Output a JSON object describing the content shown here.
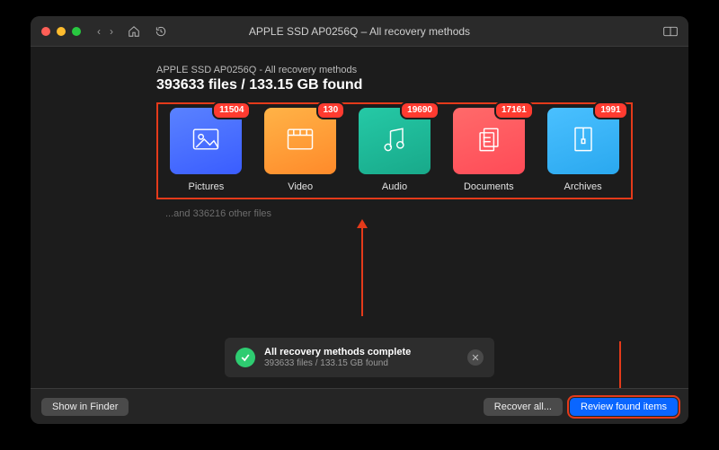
{
  "titlebar": {
    "title": "APPLE SSD AP0256Q – All recovery methods"
  },
  "header": {
    "breadcrumb": "APPLE SSD AP0256Q - All recovery methods",
    "headline": "393633 files / 133.15 GB found"
  },
  "categories": [
    {
      "name": "pictures",
      "label": "Pictures",
      "count": "11504",
      "color": "linear-gradient(160deg,#5a82ff,#3a5dff)"
    },
    {
      "name": "video",
      "label": "Video",
      "count": "130",
      "color": "linear-gradient(160deg,#ffb347,#ff8a2a)"
    },
    {
      "name": "audio",
      "label": "Audio",
      "count": "19690",
      "color": "linear-gradient(160deg,#25c9a6,#18a98a)"
    },
    {
      "name": "documents",
      "label": "Documents",
      "count": "17161",
      "color": "linear-gradient(160deg,#ff6a6a,#ff4b57)"
    },
    {
      "name": "archives",
      "label": "Archives",
      "count": "1991",
      "color": "linear-gradient(160deg,#4ac0ff,#2aa8ef)"
    }
  ],
  "other_files_text": "...and 336216 other files",
  "status": {
    "title": "All recovery methods complete",
    "subtitle": "393633 files / 133.15 GB found"
  },
  "footer": {
    "show_in_finder": "Show in Finder",
    "recover_all": "Recover all...",
    "review": "Review found items"
  }
}
